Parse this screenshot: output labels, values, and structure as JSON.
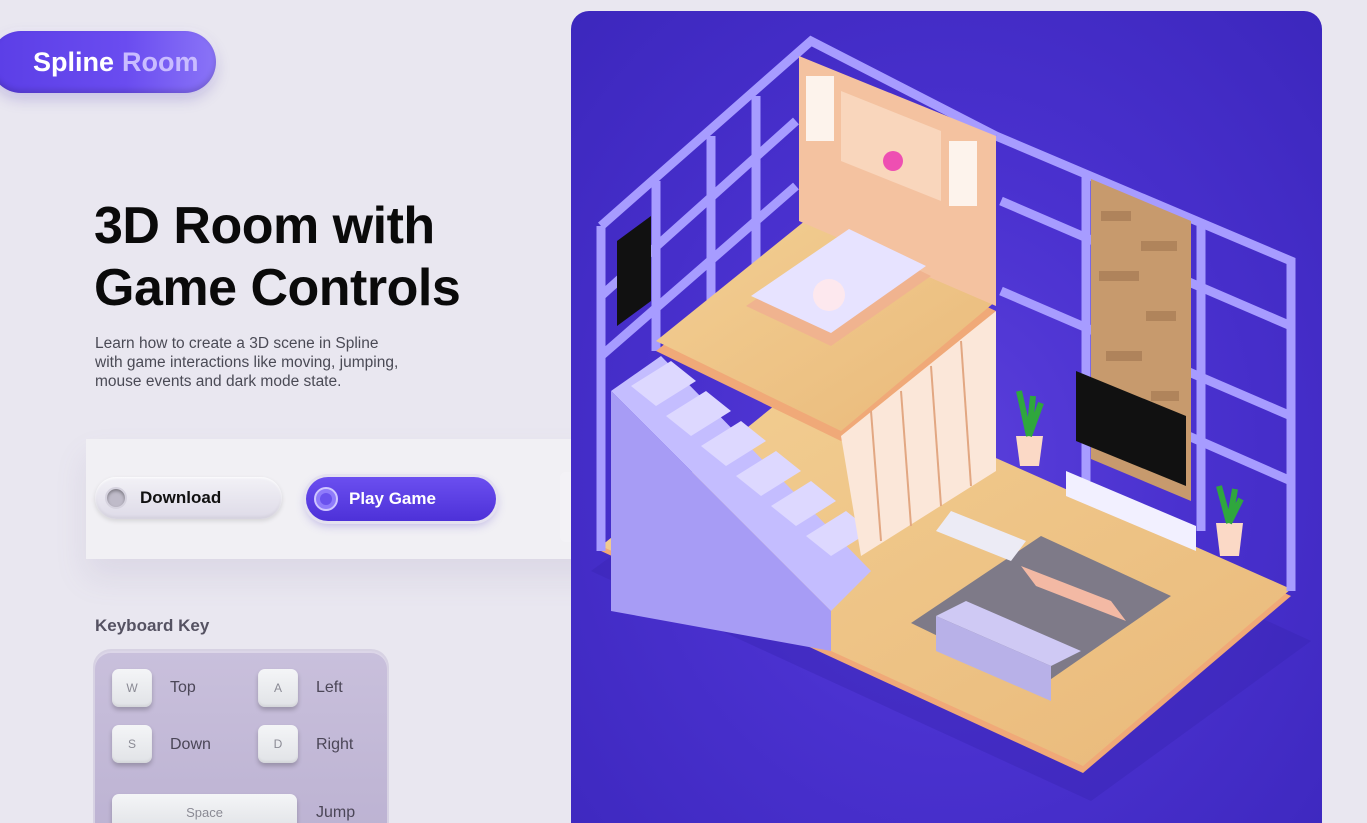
{
  "brand": {
    "name_part1": "Spline",
    "name_part2": "Room"
  },
  "hero": {
    "title_line1": "3D Room with",
    "title_line2": "Game Controls",
    "description_line1": "Learn how to create a 3D scene in Spline",
    "description_line2": "with game interactions like moving, jumping,",
    "description_line3": "mouse events and dark mode state."
  },
  "actions": {
    "download_label": "Download",
    "play_label": "Play Game"
  },
  "keyboard": {
    "title": "Keyboard Key",
    "keys": [
      {
        "key": "W",
        "label": "Top"
      },
      {
        "key": "A",
        "label": "Left"
      },
      {
        "key": "S",
        "label": "Down"
      },
      {
        "key": "D",
        "label": "Right"
      },
      {
        "key": "Space",
        "label": "Jump"
      }
    ]
  },
  "colors": {
    "accent": "#5b3ee6",
    "scene_bg": "#4a31cf",
    "page_bg": "#e9e7f0"
  }
}
